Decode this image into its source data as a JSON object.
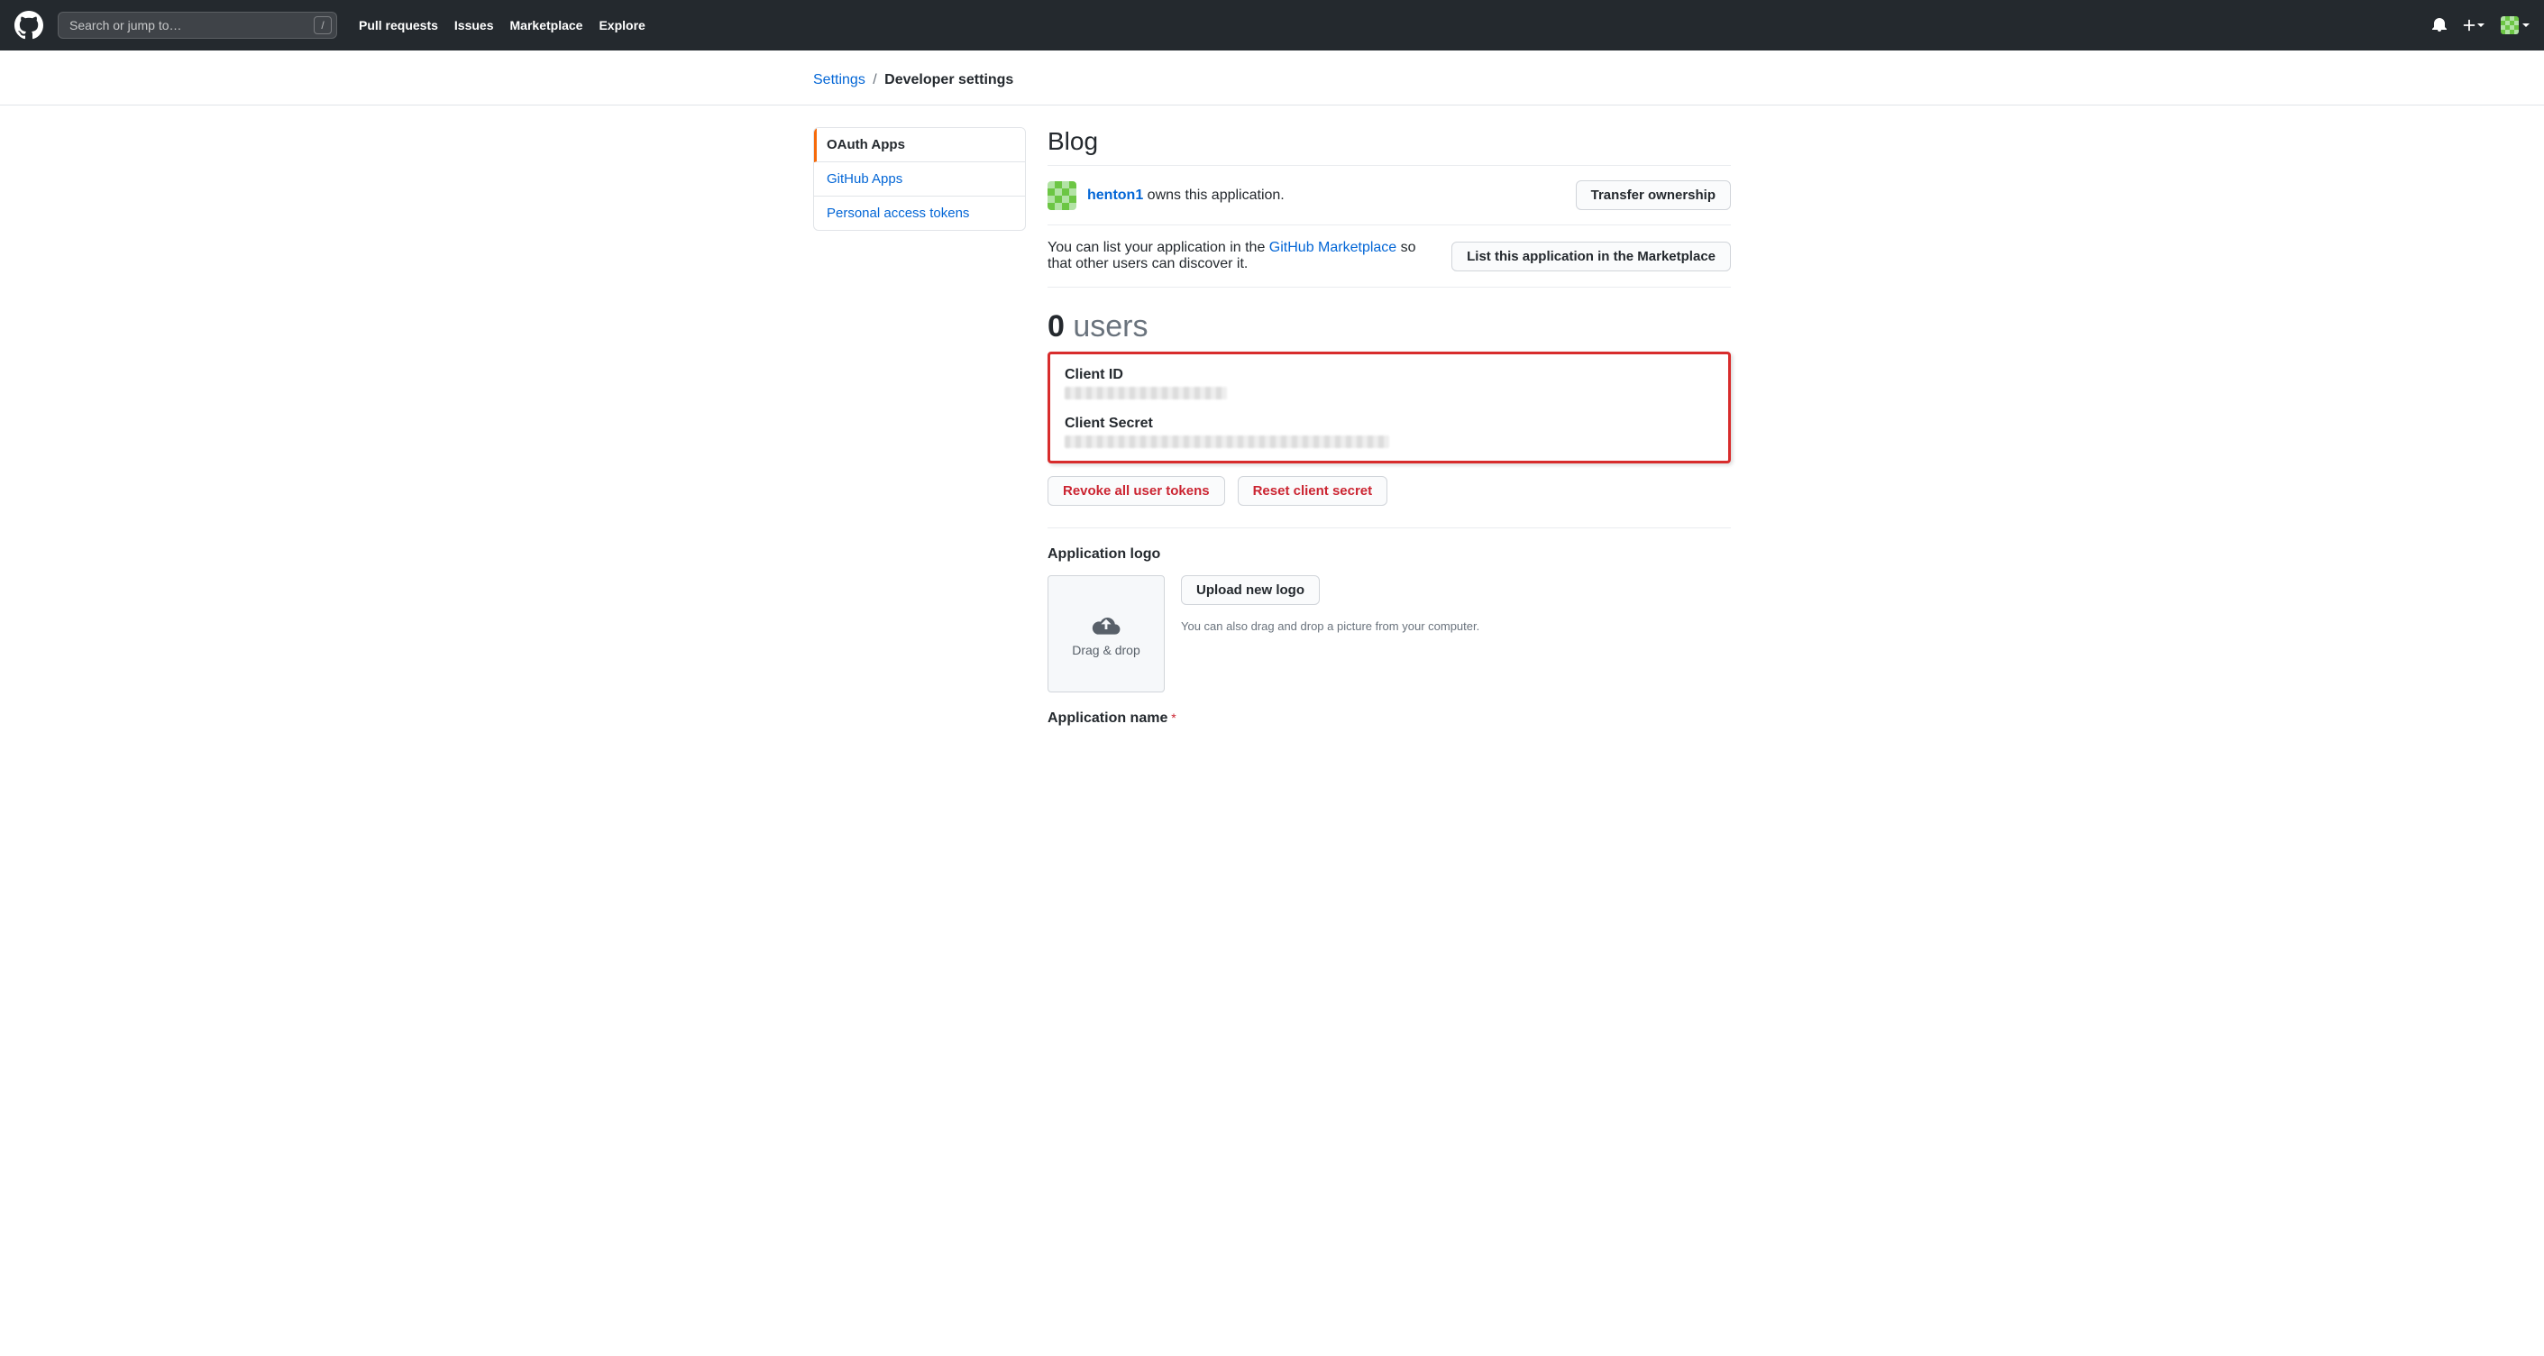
{
  "search": {
    "placeholder": "Search or jump to…",
    "slash": "/"
  },
  "nav": {
    "pull_requests": "Pull requests",
    "issues": "Issues",
    "marketplace": "Marketplace",
    "explore": "Explore"
  },
  "breadcrumb": {
    "settings": "Settings",
    "sep": "/",
    "current": "Developer settings"
  },
  "sidebar": {
    "items": [
      {
        "label": "OAuth Apps"
      },
      {
        "label": "GitHub Apps"
      },
      {
        "label": "Personal access tokens"
      }
    ]
  },
  "app": {
    "title": "Blog"
  },
  "owner": {
    "username": "henton1",
    "owns_text": " owns this application.",
    "transfer_btn": "Transfer ownership"
  },
  "market": {
    "pre": "You can list your application in the ",
    "link": "GitHub Marketplace",
    "post": " so that other users can discover it.",
    "btn": "List this application in the Marketplace"
  },
  "users": {
    "count": "0",
    "label": " users"
  },
  "secrets": {
    "client_id_label": "Client ID",
    "client_secret_label": "Client Secret"
  },
  "tokens": {
    "revoke": "Revoke all user tokens",
    "reset": "Reset client secret"
  },
  "logo": {
    "heading": "Application logo",
    "drag": "Drag & drop",
    "upload_btn": "Upload new logo",
    "tip": "You can also drag and drop a picture from your computer."
  },
  "appname": {
    "label": "Application name",
    "required": "*"
  }
}
